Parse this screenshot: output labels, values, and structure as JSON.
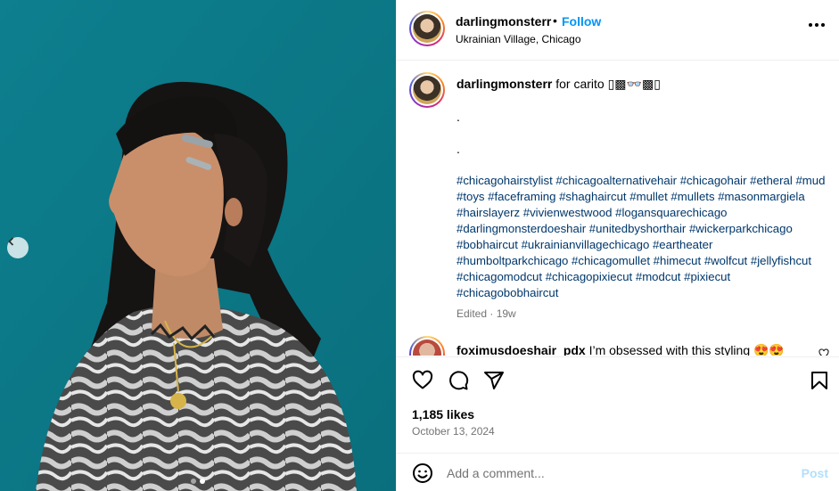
{
  "post": {
    "username": "darlingmonsterr",
    "separator": "•",
    "follow_label": "Follow",
    "location": "Ukrainian Village, Chicago",
    "more_icon": "more-horizontal-icon"
  },
  "caption": {
    "username": "darlingmonsterr",
    "text": "for carito ▯▩👓▩▯",
    "dot1": ".",
    "dot2": ".",
    "hashtags": "#chicagohairstylist #chicagoalternativehair #chicagohair #etheral #mud #toys #faceframing #shaghaircut #mullet #mullets #masonmargiela #hairslayerz #vivienwestwood #logansquarechicago #darlingmonsterdoeshair #unitedbyshorthair #wickerparkchicago #bobhaircut #ukrainianvillagechicago #eartheater #humboltparkchicago #chicagomullet #himecut #wolfcut #jellyfishcut #chicagomodcut #chicagopixiecut #modcut #pixiecut #chicagobobhaircut",
    "edited": "Edited · 19w"
  },
  "comment": {
    "username": "foximusdoeshair_pdx",
    "text": "I’m obsessed with this styling 😍😍"
  },
  "actions": {
    "like_icon": "heart-icon",
    "comment_icon": "comment-icon",
    "share_icon": "send-icon",
    "save_icon": "bookmark-icon"
  },
  "likes": "1,185 likes",
  "date": "October 13, 2024",
  "add_comment": {
    "placeholder": "Add a comment...",
    "post_label": "Post",
    "emoji_icon": "emoji-icon"
  },
  "carousel": {
    "prev_icon": "chevron-left-icon",
    "slide_count": 2,
    "active_slide": 2
  },
  "colors": {
    "link": "#00376b",
    "follow": "#0095f6",
    "post_disabled": "#b2dffc",
    "photo_bg": "#0f7d8c"
  }
}
